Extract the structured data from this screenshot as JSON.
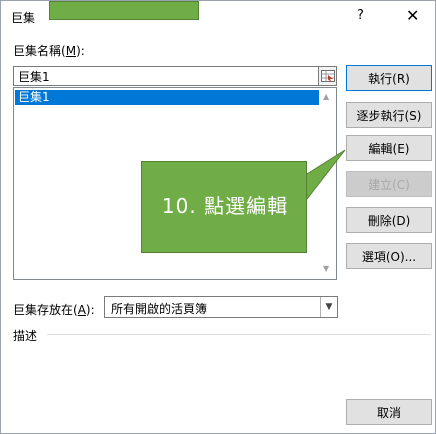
{
  "dialog": {
    "title": "巨集",
    "help_label": "?",
    "close_label": "✕"
  },
  "macro_name": {
    "label": "巨集名稱",
    "accel": "M",
    "value": "巨集1"
  },
  "macro_list": [
    "巨集1"
  ],
  "buttons": {
    "run": "執行(R)",
    "step_into": "逐步執行(S)",
    "edit": "編輯(E)",
    "create": "建立(C)",
    "delete": "刪除(D)",
    "options": "選項(O)...",
    "cancel": "取消"
  },
  "macros_in": {
    "label": "巨集存放在",
    "accel": "A",
    "value": "所有開啟的活頁簿"
  },
  "description_label": "描述",
  "callout": {
    "text": "10. 點選編輯"
  },
  "colors": {
    "callout_fill": "#70ad47",
    "selection": "#0078d7"
  }
}
